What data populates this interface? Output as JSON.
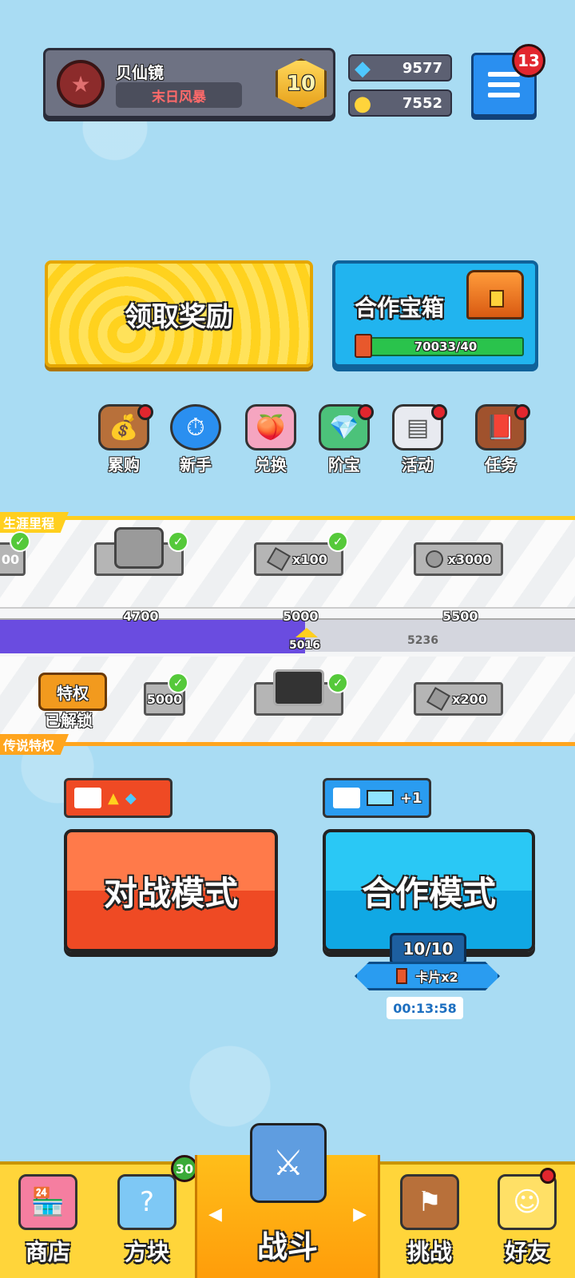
{
  "profile": {
    "name": "贝仙镜",
    "title": "末日风暴",
    "rank": "10"
  },
  "currency": {
    "gems": "9577",
    "coins": "7552"
  },
  "menu": {
    "notification_count": "13"
  },
  "claim_reward": {
    "label": "领取奖励"
  },
  "coop_chest": {
    "label": "合作宝箱",
    "progress": "70033/40"
  },
  "shortcuts": [
    {
      "label": "累购",
      "icon": "bag-icon",
      "has_dot": true
    },
    {
      "label": "新手",
      "icon": "stopwatch-icon",
      "has_dot": false
    },
    {
      "label": "兑换",
      "icon": "peach-icon",
      "has_dot": false
    },
    {
      "label": "阶宝",
      "icon": "treasure-icon",
      "has_dot": true
    },
    {
      "label": "活动",
      "icon": "document-icon",
      "has_dot": true
    },
    {
      "label": "任务",
      "icon": "book-icon",
      "has_dot": true
    }
  ],
  "career": {
    "tag": "生涯里程",
    "legend_tag": "传说特权",
    "top_rewards": [
      "00",
      "",
      "x100",
      "x3000"
    ],
    "track_labels": [
      "4700",
      "5000",
      "5500"
    ],
    "current": "5016",
    "next_value": "5236",
    "progress_fraction": 0.53,
    "bottom_rewards": [
      "5000",
      "",
      "x200"
    ],
    "privilege_badge": "特权",
    "privilege_status": "已解锁"
  },
  "modes": {
    "battle": {
      "label": "对战模式"
    },
    "coop": {
      "label": "合作模式",
      "bonus": "+1",
      "count": "10/10",
      "card_bonus": "卡片x2",
      "timer": "00:13:58"
    }
  },
  "nav": {
    "shop": "商店",
    "blocks": "方块",
    "blocks_badge": "30",
    "battle": "战斗",
    "challenge": "挑战",
    "friends": "好友"
  },
  "colors": {
    "background": "#a9dcf3",
    "accent_yellow": "#ffd21e",
    "accent_blue": "#21b4ef",
    "battle_red": "#ef4a24",
    "nav_yellow": "#ffd53a"
  }
}
